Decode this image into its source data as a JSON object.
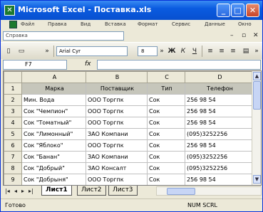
{
  "window": {
    "title": "Microsoft Excel - Поставка.xls"
  },
  "menu": [
    "Файл",
    "Правка",
    "Вид",
    "Вставка",
    "Формат",
    "Сервис",
    "Данные",
    "Окно"
  ],
  "help": {
    "placeholder": "Справка"
  },
  "toolbar": {
    "font": "Arial Cyr",
    "size": "8",
    "bold": "Ж",
    "italic": "К",
    "underline": "Ч"
  },
  "formula": {
    "cell_ref": "F7",
    "fx": "fx",
    "value": ""
  },
  "sheet": {
    "columns": [
      "A",
      "B",
      "C",
      "D"
    ],
    "rows": [
      {
        "num": "1",
        "cells": [
          "Марка",
          "Поставщик",
          "Тип",
          "Телефон"
        ]
      },
      {
        "num": "2",
        "cells": [
          "Мин. Вода",
          "ООО Торгпк",
          "Сок",
          "256 98 54"
        ]
      },
      {
        "num": "3",
        "cells": [
          "Сок \"Чемпион\"",
          "ООО Торгпк",
          "Сок",
          "256 98 54"
        ]
      },
      {
        "num": "4",
        "cells": [
          "Сок \"Томатный\"",
          "ООО Торгпк",
          "Сок",
          "256 98 54"
        ]
      },
      {
        "num": "5",
        "cells": [
          "Сок \"Лимонный\"",
          "ЗАО Компани",
          "Сок",
          "(095)3252256"
        ]
      },
      {
        "num": "6",
        "cells": [
          "Сок \"Яблоко\"",
          "ООО Торгпк",
          "Сок",
          "256 98 54"
        ]
      },
      {
        "num": "7",
        "cells": [
          "Сок \"Банан\"",
          "ЗАО Компани",
          "Сок",
          "(095)3252256"
        ]
      },
      {
        "num": "8",
        "cells": [
          "Сок \"Добрый\"",
          "ЗАО Консалт",
          "Сок",
          "(095)3252256"
        ]
      },
      {
        "num": "9",
        "cells": [
          "Сок \"Добрыня\"",
          "ООО Торгпк",
          "Сок",
          "256 98 54"
        ]
      }
    ]
  },
  "tabs": [
    "Лист1",
    "Лист2",
    "Лист3"
  ],
  "status": {
    "text": "Готово",
    "indicators": "NUM  SCRL"
  }
}
